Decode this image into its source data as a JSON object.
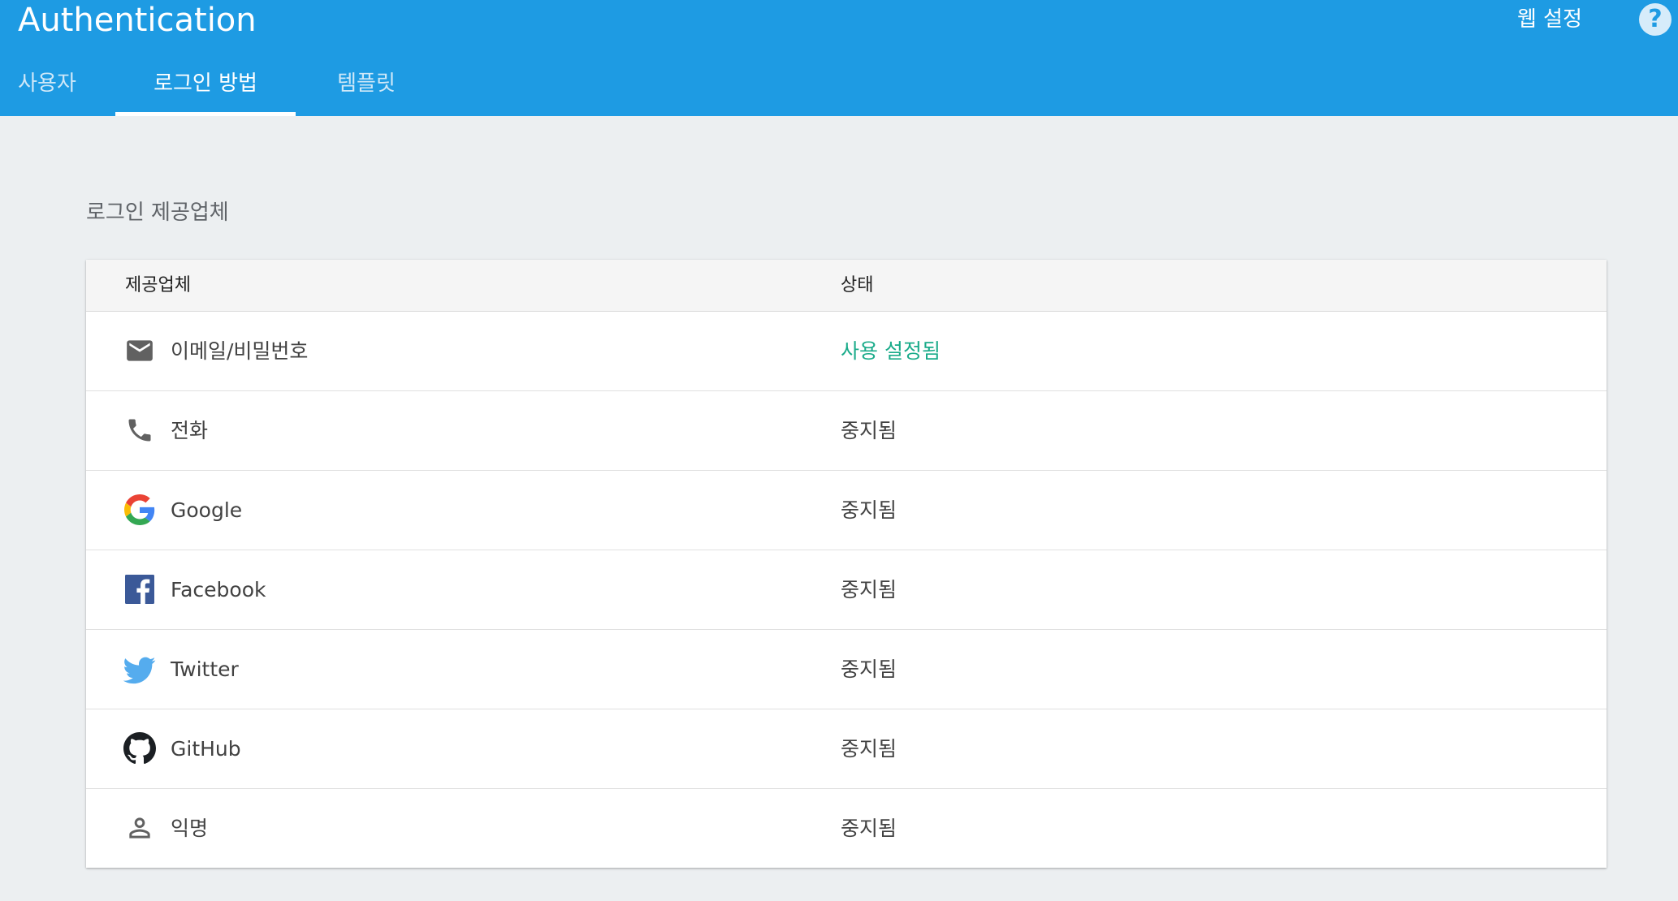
{
  "header": {
    "title": "Authentication",
    "web_setup_label": "웹 설정",
    "help_glyph": "?",
    "colors": {
      "background": "#1e9be3",
      "text": "#ffffff"
    }
  },
  "tabs": [
    {
      "label": "사용자",
      "active": false
    },
    {
      "label": "로그인 방법",
      "active": true
    },
    {
      "label": "템플릿",
      "active": false
    }
  ],
  "section": {
    "title": "로그인 제공업체"
  },
  "table": {
    "columns": [
      "제공업체",
      "상태"
    ],
    "rows": [
      {
        "icon": "email-icon",
        "name": "이메일/비밀번호",
        "status": "사용 설정됨",
        "status_color": "#1aab8a"
      },
      {
        "icon": "phone-icon",
        "name": "전화",
        "status": "중지됨",
        "status_color": "#424242"
      },
      {
        "icon": "google-icon",
        "name": "Google",
        "status": "중지됨",
        "status_color": "#424242"
      },
      {
        "icon": "facebook-icon",
        "name": "Facebook",
        "status": "중지됨",
        "status_color": "#424242"
      },
      {
        "icon": "twitter-icon",
        "name": "Twitter",
        "status": "중지됨",
        "status_color": "#424242"
      },
      {
        "icon": "github-icon",
        "name": "GitHub",
        "status": "중지됨",
        "status_color": "#424242"
      },
      {
        "icon": "anonymous-user-icon",
        "name": "익명",
        "status": "중지됨",
        "status_color": "#424242"
      }
    ]
  }
}
